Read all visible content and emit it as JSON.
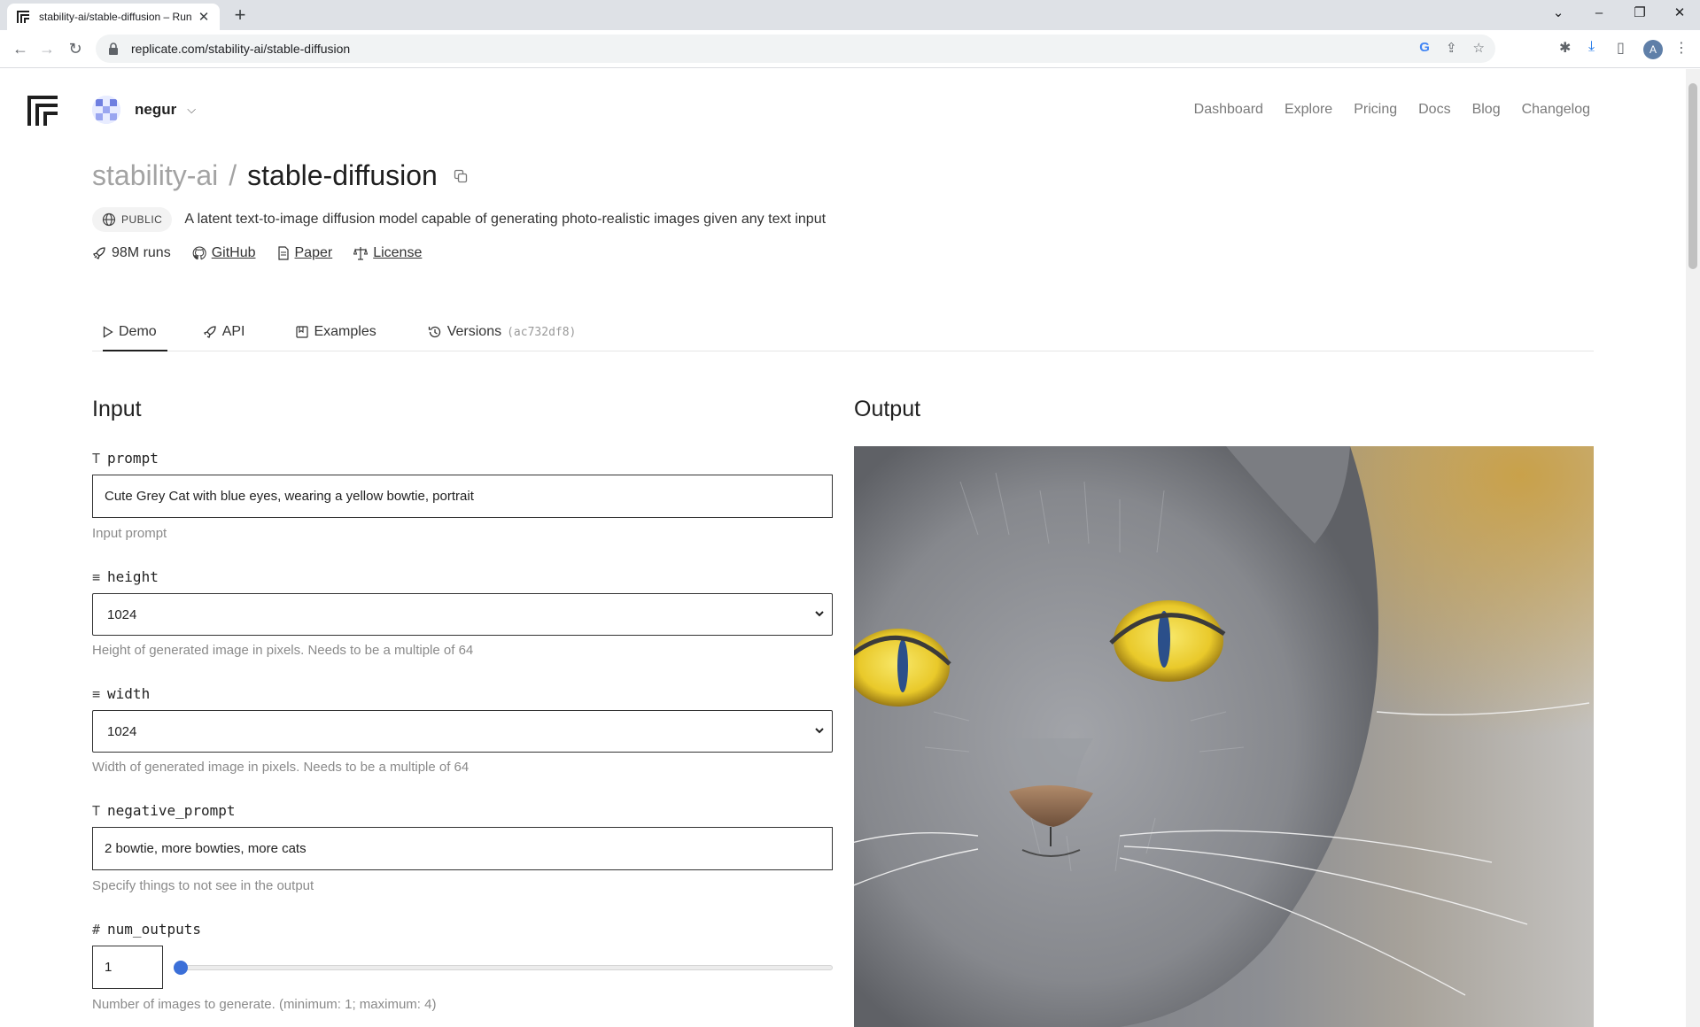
{
  "browser": {
    "tab_title": "stability-ai/stable-diffusion – Run",
    "url": "replicate.com/stability-ai/stable-diffusion",
    "profile_initial": "A"
  },
  "header": {
    "username": "negur",
    "nav": [
      "Dashboard",
      "Explore",
      "Pricing",
      "Docs",
      "Blog",
      "Changelog"
    ]
  },
  "model": {
    "owner": "stability-ai",
    "separator": "/",
    "name": "stable-diffusion",
    "visibility": "PUBLIC",
    "description": "A latent text-to-image diffusion model capable of generating photo-realistic images given any text input",
    "runs": "98M runs",
    "github": "GitHub",
    "paper": "Paper",
    "license": "License"
  },
  "tabs": {
    "demo": "Demo",
    "api": "API",
    "examples": "Examples",
    "versions": "Versions",
    "version_hash": "(ac732df8)"
  },
  "input": {
    "heading": "Input",
    "prompt": {
      "type_glyph": "T",
      "label": "prompt",
      "value": "Cute Grey Cat with blue eyes, wearing a yellow bowtie, portrait",
      "hint": "Input prompt"
    },
    "height": {
      "type_glyph": "≡",
      "label": "height",
      "value": "1024",
      "hint": "Height of generated image in pixels. Needs to be a multiple of 64"
    },
    "width": {
      "type_glyph": "≡",
      "label": "width",
      "value": "1024",
      "hint": "Width of generated image in pixels. Needs to be a multiple of 64"
    },
    "negative_prompt": {
      "type_glyph": "T",
      "label": "negative_prompt",
      "value": "2 bowtie, more bowties, more cats",
      "hint": "Specify things to not see in the output"
    },
    "num_outputs": {
      "type_glyph": "#",
      "label": "num_outputs",
      "value": "1",
      "slider_fraction": 0,
      "hint": "Number of images to generate. (minimum: 1; maximum: 4)"
    }
  },
  "output": {
    "heading": "Output"
  },
  "colors": {
    "accent": "#3b6fd8",
    "cat_fur": "#8d8f94",
    "cat_eye": "#f2d23a"
  }
}
